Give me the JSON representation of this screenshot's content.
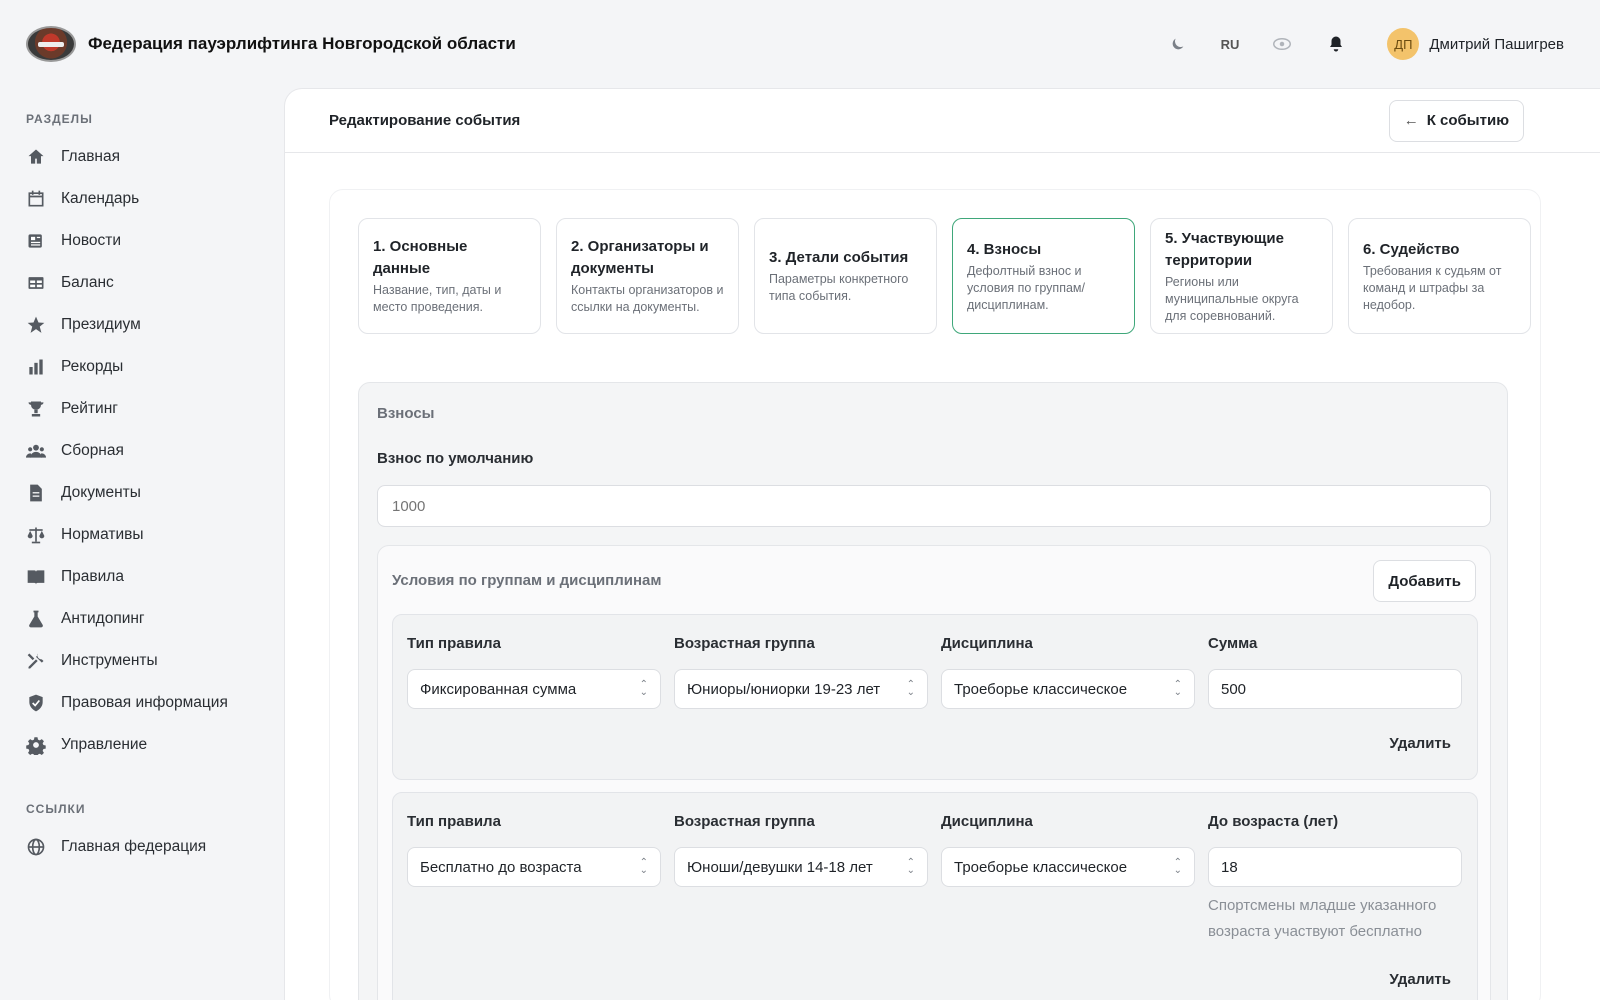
{
  "header": {
    "app_title": "Федерация пауэрлифтинга Новгородской области",
    "lang": "RU",
    "user_initials": "ДП",
    "user_name": "Дмитрий Пашигрев",
    "icons": [
      "moon-icon",
      "eye-icon",
      "bell-icon"
    ]
  },
  "sidebar": {
    "section_sections": "РАЗДЕЛЫ",
    "items": [
      {
        "label": "Главная",
        "icon": "home-icon"
      },
      {
        "label": "Календарь",
        "icon": "calendar-icon"
      },
      {
        "label": "Новости",
        "icon": "news-icon"
      },
      {
        "label": "Баланс",
        "icon": "table-icon"
      },
      {
        "label": "Президиум",
        "icon": "star-icon"
      },
      {
        "label": "Рекорды",
        "icon": "bar-chart-icon"
      },
      {
        "label": "Рейтинг",
        "icon": "trophy-icon"
      },
      {
        "label": "Сборная",
        "icon": "users-icon"
      },
      {
        "label": "Документы",
        "icon": "document-icon"
      },
      {
        "label": "Нормативы",
        "icon": "scales-icon"
      },
      {
        "label": "Правила",
        "icon": "book-icon"
      },
      {
        "label": "Антидопинг",
        "icon": "flask-icon"
      },
      {
        "label": "Инструменты",
        "icon": "tools-icon"
      },
      {
        "label": "Правовая информация",
        "icon": "shield-icon"
      },
      {
        "label": "Управление",
        "icon": "gear-icon"
      }
    ],
    "section_links": "ССЫЛКИ",
    "links": [
      {
        "label": "Главная федерация",
        "icon": "globe-icon"
      }
    ]
  },
  "main": {
    "page_title": "Редактирование события",
    "back_label": "К событию",
    "steps": [
      {
        "title": "1. Основные данные",
        "desc": "Название, тип, даты и место проведения."
      },
      {
        "title": "2. Организаторы и документы",
        "desc": "Контакты организаторов и ссылки на документы."
      },
      {
        "title": "3. Детали события",
        "desc": "Параметры конкретного типа события."
      },
      {
        "title": "4. Взносы",
        "desc": "Дефолтный взнос и условия по группам/дисциплинам."
      },
      {
        "title": "5. Участвующие территории",
        "desc": "Регионы или муниципальные округа для соревнований."
      },
      {
        "title": "6. Судейство",
        "desc": "Требования к судьям от команд и штрафы за недобор."
      }
    ],
    "active_step": 4,
    "fees": {
      "heading": "Взносы",
      "default_label": "Взнос по умолчанию",
      "default_placeholder": "1000",
      "conditions_title": "Условия по группам и дисциплинам",
      "add_label": "Добавить",
      "rules": [
        {
          "labels": [
            "Тип правила",
            "Возрастная группа",
            "Дисциплина",
            "Сумма"
          ],
          "rule_type": "Фиксированная сумма",
          "age_group": "Юниоры/юниорки 19-23 лет",
          "discipline": "Троеборье классическое",
          "value": "500",
          "delete_label": "Удалить"
        },
        {
          "labels": [
            "Тип правила",
            "Возрастная группа",
            "Дисциплина",
            "До возраста (лет)"
          ],
          "rule_type": "Бесплатно до возраста",
          "age_group": "Юноши/девушки 14-18 лет",
          "discipline": "Троеборье классическое",
          "value": "18",
          "hint": "Спортсмены младше указанного возраста участвуют бесплатно",
          "delete_label": "Удалить"
        }
      ]
    }
  }
}
